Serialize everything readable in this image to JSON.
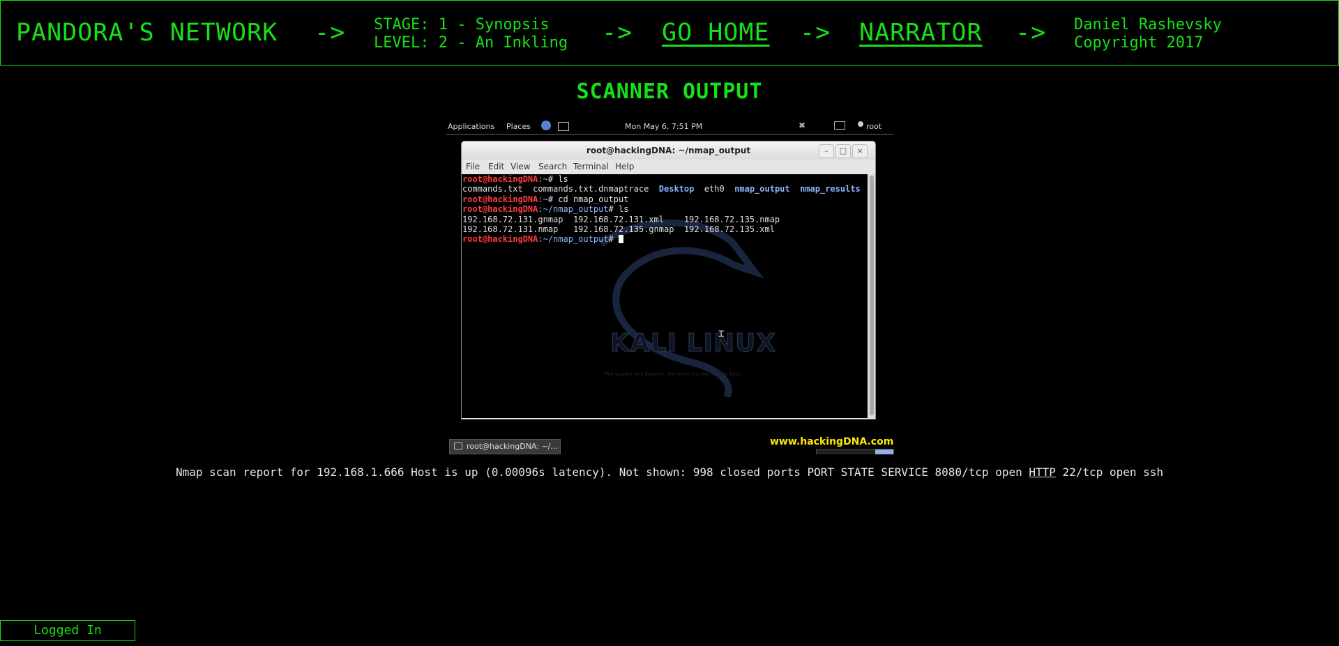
{
  "header": {
    "site_title": "PANDORA'S NETWORK",
    "arrow": "->",
    "stage": "STAGE: 1 - Synopsis",
    "level": "LEVEL: 2 - An Inkling",
    "go_home": "GO HOME",
    "narrator": "NARRATOR",
    "author": "Daniel Rashevsky",
    "copyright": "Copyright 2017"
  },
  "page_title": "SCANNER OUTPUT",
  "screenshot": {
    "gnome_bar": {
      "applications": "Applications",
      "places": "Places",
      "clock": "Mon May  6,  7:51 PM",
      "user": "root"
    },
    "window": {
      "title": "root@hackingDNA: ~/nmap_output",
      "menu": [
        "File",
        "Edit",
        "View",
        "Search",
        "Terminal",
        "Help"
      ],
      "terminal": {
        "prompt_user": "root@hackingDNA",
        "l1_path": ":~",
        "l1_cmd": "# ls",
        "files_plain": "commands.txt  commands.txt.dnmaptrace  ",
        "dir_desktop": "Desktop",
        "file_eth0": "  eth0  ",
        "dir_nmap_output": "nmap_output",
        "dir_nmap_results": "nmap_results",
        "l3_path": ":~",
        "l3_cmd": "# cd nmap_output",
        "l4_path": ":~/nmap_output",
        "l4_cmd": "# ls",
        "l5": "192.168.72.131.gnmap  192.168.72.131.xml    192.168.72.135.nmap",
        "l6": "192.168.72.131.nmap   192.168.72.135.gnmap  192.168.72.135.xml",
        "l7_path": ":~/nmap_output",
        "l7_cmd": "# "
      },
      "watermark": "KALI LINUX",
      "tagline": "The quieter you become, the more you are able to hear"
    },
    "taskbar_item": "root@hackingDNA: ~/...",
    "url": "www.hackingDNA.com"
  },
  "report": {
    "before": "Nmap scan report for 192.168.1.666 Host is up (0.00096s latency). Not shown: 998 closed ports PORT STATE SERVICE 8080/tcp open ",
    "http_link": "HTTP",
    "after": " 22/tcp open ssh"
  },
  "status": {
    "logged_in": "Logged In"
  }
}
